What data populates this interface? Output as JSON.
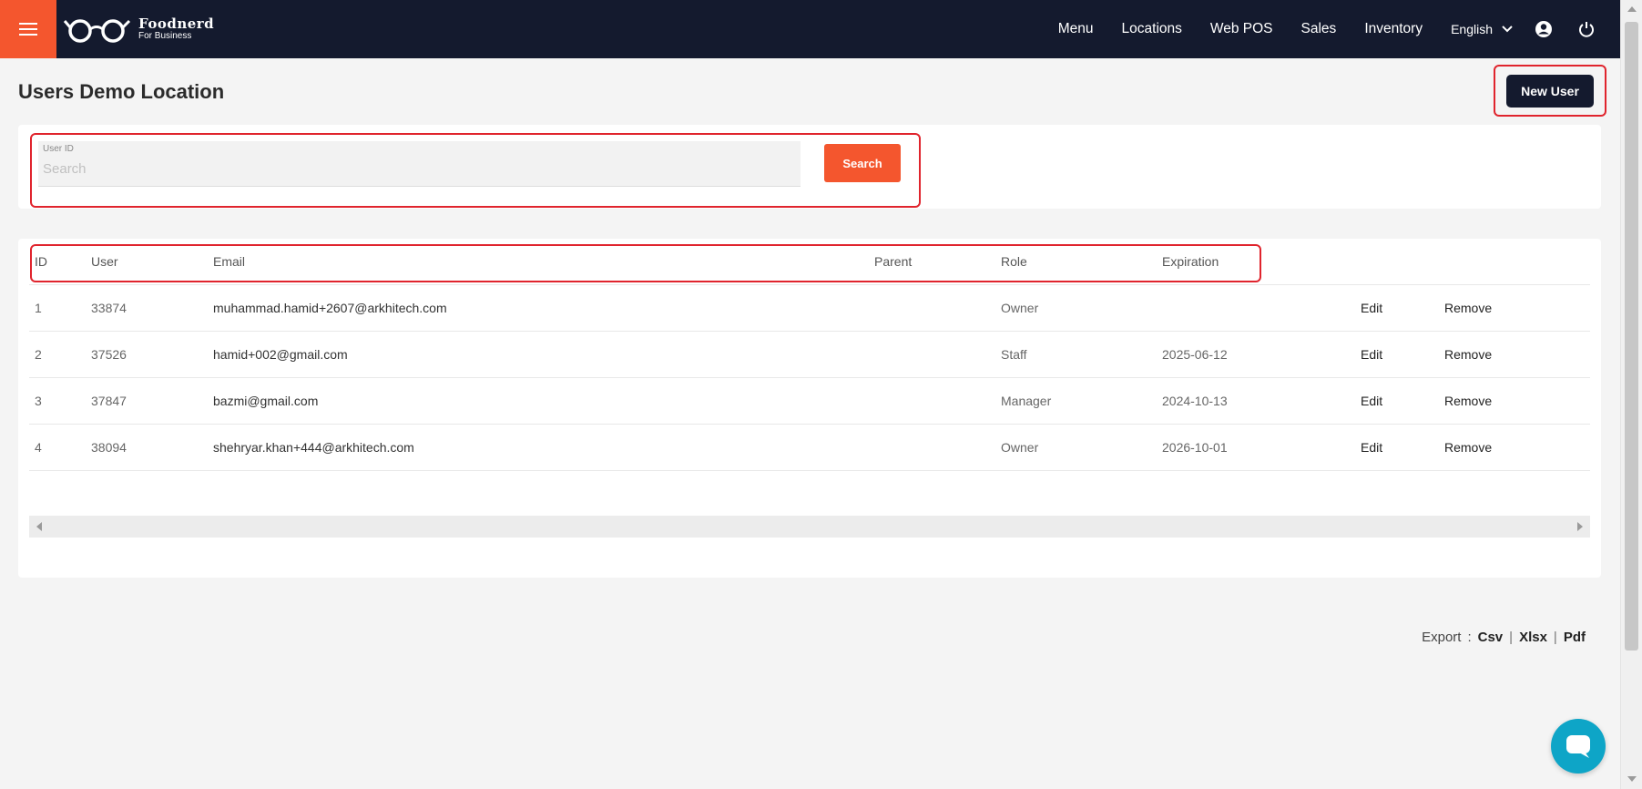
{
  "brand": {
    "name": "Foodnerd",
    "tagline": "For Business"
  },
  "nav": {
    "items": [
      "Menu",
      "Locations",
      "Web POS",
      "Sales",
      "Inventory"
    ],
    "language": "English"
  },
  "page": {
    "title": "Users Demo Location",
    "new_user_label": "New User"
  },
  "search": {
    "label": "User ID",
    "placeholder": "Search",
    "value": "",
    "button_label": "Search"
  },
  "table": {
    "columns": [
      "ID",
      "User",
      "Email",
      "Parent",
      "Role",
      "Expiration"
    ],
    "rows": [
      {
        "id": "1",
        "user": "33874",
        "email": "muhammad.hamid+2607@arkhitech.com",
        "parent": "",
        "role": "Owner",
        "expiration": "",
        "edit": "Edit",
        "remove": "Remove"
      },
      {
        "id": "2",
        "user": "37526",
        "email": "hamid+002@gmail.com",
        "parent": "",
        "role": "Staff",
        "expiration": "2025-06-12",
        "edit": "Edit",
        "remove": "Remove"
      },
      {
        "id": "3",
        "user": "37847",
        "email": "bazmi@gmail.com",
        "parent": "",
        "role": "Manager",
        "expiration": "2024-10-13",
        "edit": "Edit",
        "remove": "Remove"
      },
      {
        "id": "4",
        "user": "38094",
        "email": "shehryar.khan+444@arkhitech.com",
        "parent": "",
        "role": "Owner",
        "expiration": "2026-10-01",
        "edit": "Edit",
        "remove": "Remove"
      }
    ]
  },
  "export": {
    "label": "Export",
    "colon": ":",
    "formats": [
      "Csv",
      "Xlsx",
      "Pdf"
    ],
    "separator": "|"
  },
  "colors": {
    "navbar": "#141a2e",
    "accent": "#f4562e",
    "highlight": "#e0242d",
    "chat": "#0ea5c7"
  },
  "icons": {
    "menu": "hamburger-icon",
    "language_dropdown": "chevron-down-icon",
    "account": "user-circle-icon",
    "logout": "power-icon",
    "chat": "chat-bubble-icon",
    "logo": "glasses-icon"
  }
}
